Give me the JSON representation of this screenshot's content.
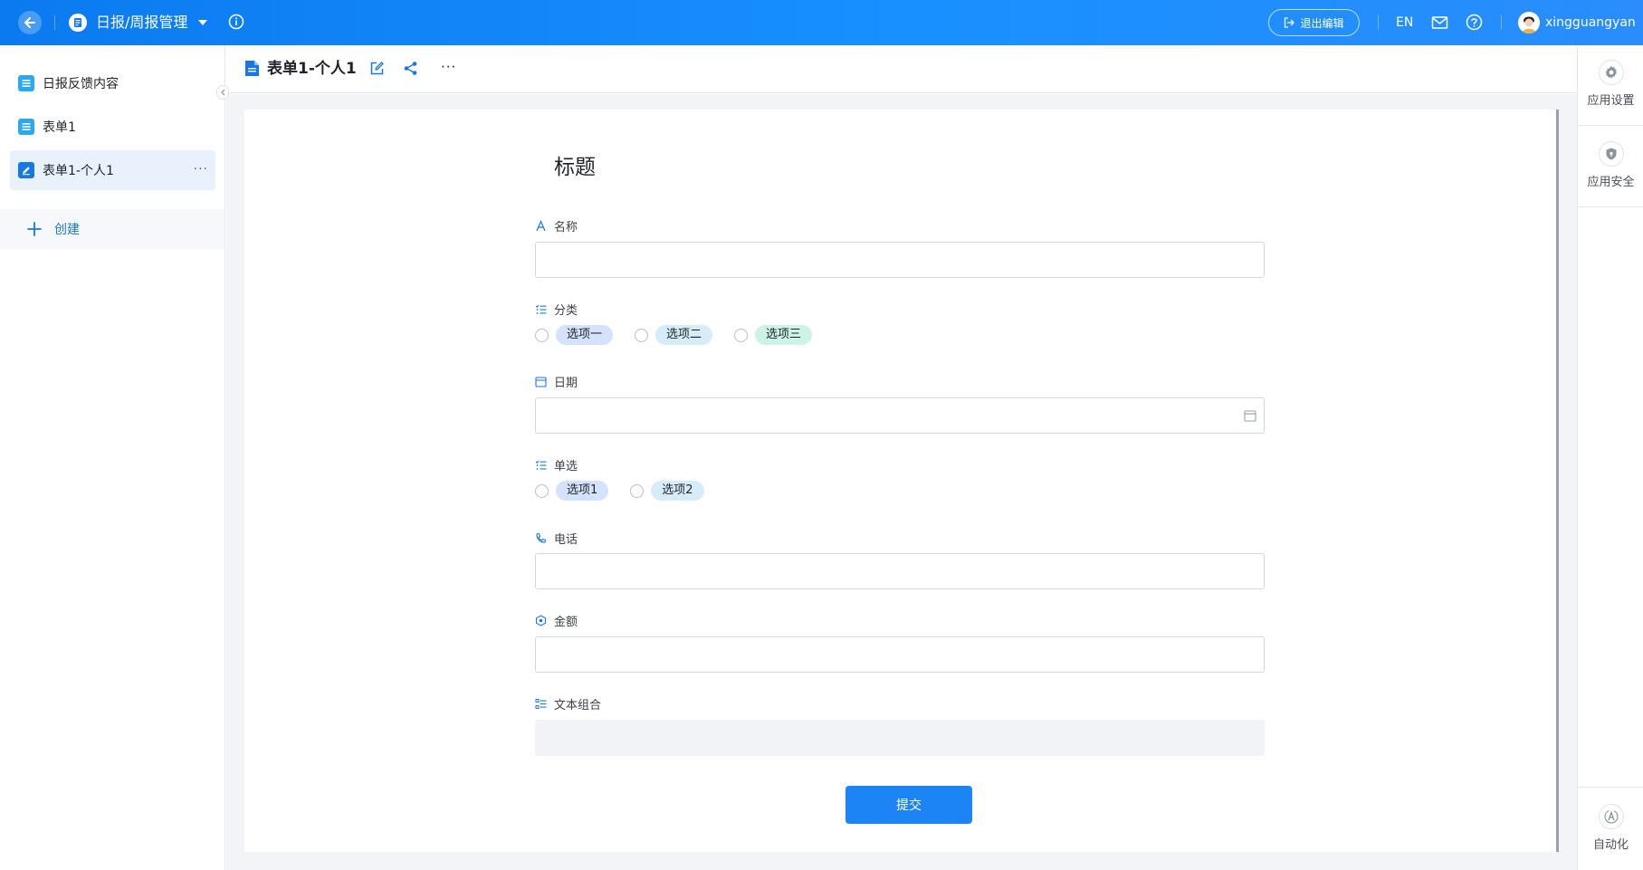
{
  "topbar": {
    "app_title": "日报/周报管理",
    "exit_label": "退出编辑",
    "lang_label": "EN",
    "username": "xingguangyan"
  },
  "sidebar": {
    "items": [
      {
        "label": "日报反馈内容",
        "icon": "list-form-icon"
      },
      {
        "label": "表单1",
        "icon": "list-form-icon"
      },
      {
        "label": "表单1-个人1",
        "icon": "edit-form-icon",
        "active": true
      }
    ],
    "more_label": "···",
    "create_label": "创建"
  },
  "header": {
    "doc_title": "表单1-个人1",
    "more_label": "···"
  },
  "form": {
    "title": "标题",
    "fields": {
      "name": {
        "label": "名称",
        "value": ""
      },
      "category": {
        "label": "分类",
        "options": [
          "选项一",
          "选项二",
          "选项三"
        ]
      },
      "date": {
        "label": "日期",
        "value": ""
      },
      "single": {
        "label": "单选",
        "options": [
          "选项1",
          "选项2"
        ]
      },
      "phone": {
        "label": "电话",
        "value": ""
      },
      "amount": {
        "label": "金额",
        "value": ""
      },
      "text_group": {
        "label": "文本组合",
        "value": ""
      }
    },
    "submit_label": "提交"
  },
  "right_panel": {
    "items": [
      {
        "label": "应用设置",
        "icon": "gear-icon"
      },
      {
        "label": "应用安全",
        "icon": "shield-icon"
      },
      {
        "label": "自动化",
        "icon": "automation-icon"
      }
    ]
  },
  "colors": {
    "topbar_start": "#0b7af0",
    "topbar_end": "#2a8dfb",
    "accent": "#1d84f6",
    "active_bg": "#e8f1fc",
    "chip_blue": "#d4e3fb",
    "chip_lightblue": "#d6ecf9",
    "chip_green": "#cdf3e6"
  }
}
